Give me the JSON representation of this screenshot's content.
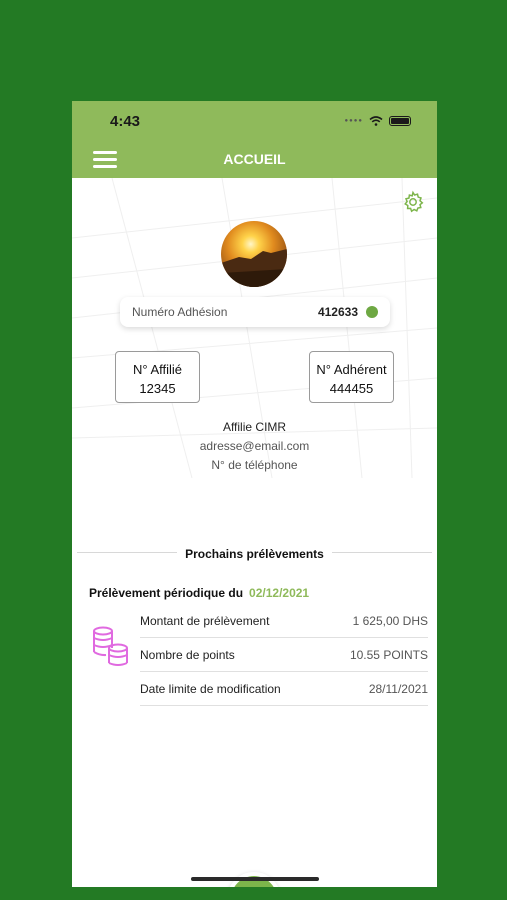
{
  "status_bar": {
    "time": "4:43"
  },
  "app_bar": {
    "title": "ACCUEIL"
  },
  "profile": {
    "adhesion_label": "Numéro Adhésion",
    "adhesion_value": "412633",
    "affilie_label": "N° Affilié",
    "affilie_value": "12345",
    "adherent_label": "N° Adhérent",
    "adherent_value": "444455",
    "name": "Affilie CIMR",
    "email": "adresse@email.com",
    "phone": "N° de téléphone"
  },
  "upcoming": {
    "section_title": "Prochains prélèvements",
    "periodic_label": "Prélèvement périodique du",
    "periodic_date": "02/12/2021",
    "rows": [
      {
        "label": "Montant de prélèvement",
        "value": "1 625,00 DHS"
      },
      {
        "label": "Nombre de points",
        "value": "10.55 POINTS"
      },
      {
        "label": "Date limite de modification",
        "value": "28/11/2021"
      }
    ]
  },
  "actions": {
    "add_icon": "+"
  },
  "colors": {
    "accent": "#8fba5b",
    "background": "#237a24",
    "coins": "#e06ae0",
    "status_dot": "#6ea843"
  },
  "icons": [
    "menu-icon",
    "gear-icon",
    "coins-icon",
    "plus-icon",
    "wifi-icon",
    "battery-icon"
  ]
}
